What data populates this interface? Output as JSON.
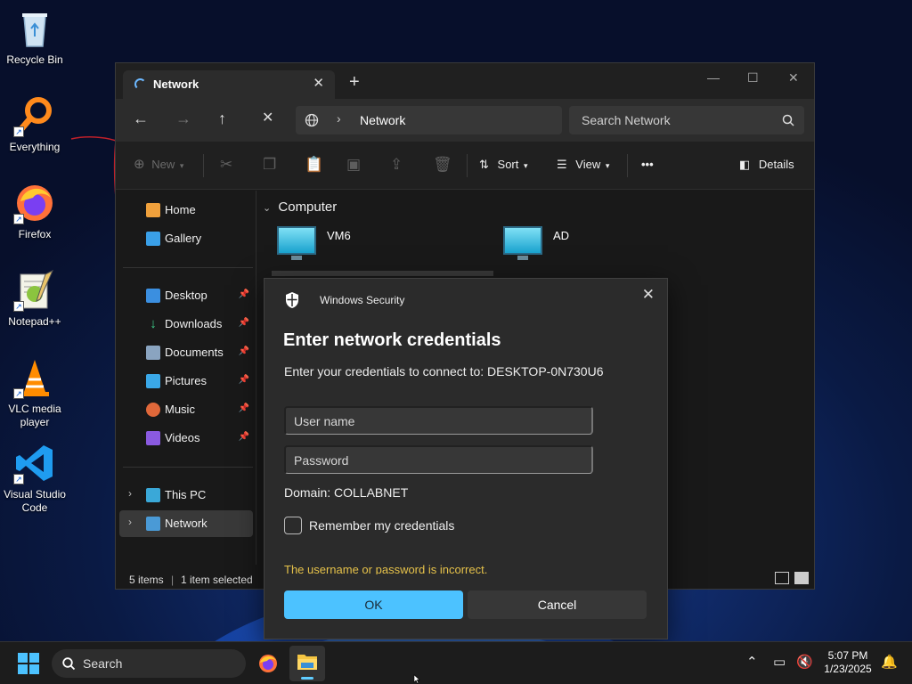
{
  "desktop": {
    "icons": [
      {
        "label": "Recycle Bin",
        "icon": "recycle-bin-icon"
      },
      {
        "label": "Everything",
        "icon": "everything-search-icon"
      },
      {
        "label": "Firefox",
        "icon": "firefox-icon"
      },
      {
        "label": "Notepad++",
        "icon": "notepad-plus-plus-icon"
      },
      {
        "label": "VLC media player",
        "icon": "vlc-icon"
      },
      {
        "label": "Visual Studio Code",
        "icon": "vscode-icon"
      }
    ]
  },
  "explorer": {
    "tab_title": "Network",
    "new_tab_glyph": "+",
    "breadcrumb": "Network",
    "search_placeholder": "Search Network",
    "toolbar": {
      "new_label": "New",
      "sort_label": "Sort",
      "view_label": "View",
      "more_label": "•••",
      "details_label": "Details"
    },
    "sidebar": {
      "items": [
        {
          "label": "Home"
        },
        {
          "label": "Gallery"
        },
        {
          "label": "Desktop"
        },
        {
          "label": "Downloads"
        },
        {
          "label": "Documents"
        },
        {
          "label": "Pictures"
        },
        {
          "label": "Music"
        },
        {
          "label": "Videos"
        },
        {
          "label": "This PC"
        },
        {
          "label": "Network"
        }
      ]
    },
    "content": {
      "group_label": "Computer",
      "computers": [
        {
          "label": "VM6"
        },
        {
          "label": "AD"
        }
      ]
    },
    "status": {
      "items": "5 items",
      "selected": "1 item selected"
    }
  },
  "dialog": {
    "app_name": "Windows Security",
    "title": "Enter network credentials",
    "prompt": "Enter your credentials to connect to: DESKTOP-0N730U6",
    "username_placeholder": "User name",
    "password_placeholder": "Password",
    "domain": "Domain: COLLABNET",
    "remember_label": "Remember my credentials",
    "error": "The username or password is incorrect.",
    "ok_label": "OK",
    "cancel_label": "Cancel"
  },
  "taskbar": {
    "search_label": "Search",
    "time": "5:07 PM",
    "date": "1/23/2025"
  },
  "colors": {
    "accent": "#4cc2ff",
    "error": "#e6c24a",
    "window_bg": "#191919"
  }
}
